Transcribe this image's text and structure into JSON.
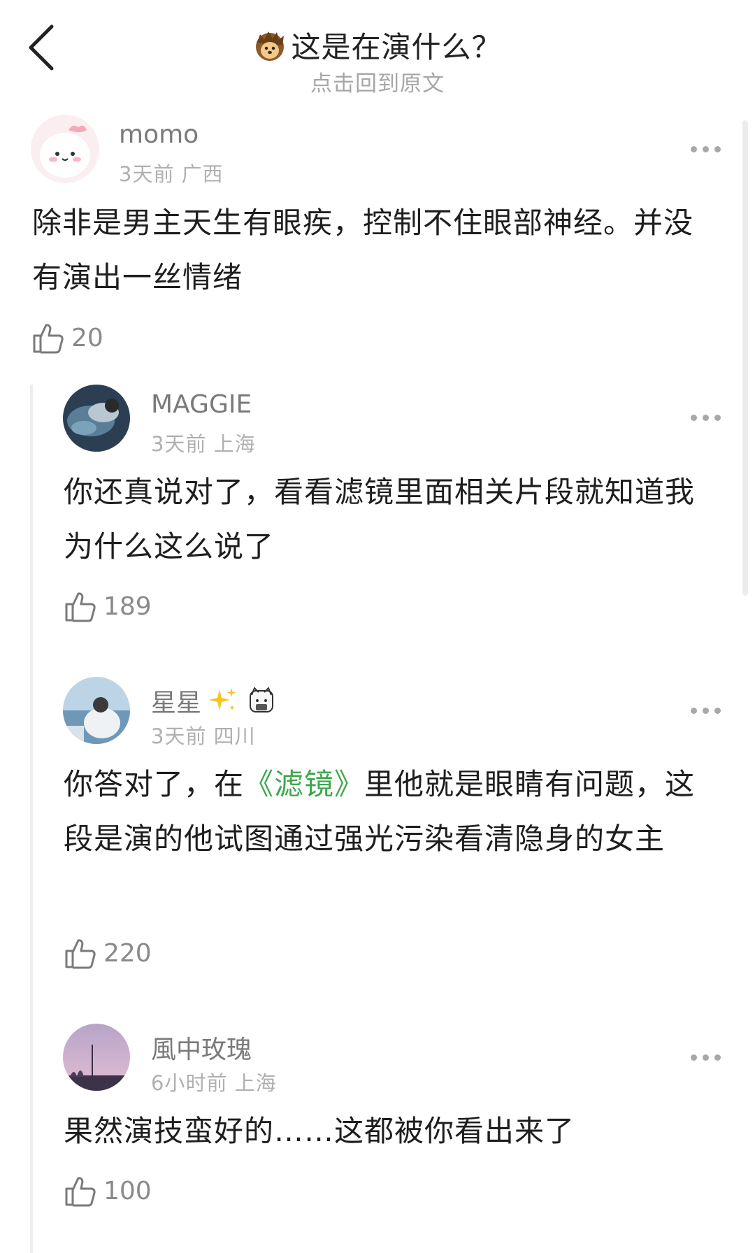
{
  "header": {
    "title": "这是在演什么？",
    "subtitle": "点击回到原文"
  },
  "comments": [
    {
      "username": "momo",
      "time": "3天前",
      "location": "广西",
      "body": "除非是男主天生有眼疾，控制不住眼部神经。并没有演出一丝情绪",
      "likes": "20"
    },
    {
      "username": "MAGGIE",
      "time": "3天前",
      "location": "上海",
      "body": "你还真说对了，看看滤镜里面相关片段就知道我为什么这么说了",
      "likes": "189"
    },
    {
      "username": "星星",
      "time": "3天前",
      "location": "四川",
      "body_parts": [
        "你答对了，在",
        "《滤镜》",
        "里他就是眼睛有问题，这段是演的他试图通过强光污染看清隐身的女主"
      ],
      "likes": "220"
    },
    {
      "username": "風中玫瑰",
      "time": "6小时前",
      "location": "上海",
      "body": "果然演技蛮好的……这都被你看出来了",
      "likes": "100"
    }
  ],
  "colors": {
    "link_green": "#3ea64d",
    "muted_gray": "#b0b0b0",
    "thread_line": "#ededed"
  },
  "icons": {
    "back": "chevron-left-icon",
    "title_emoji": "hedgehog-emoji-icon",
    "more": "ellipsis-icon",
    "like": "thumbs-up-icon",
    "username_badge": "sparkles-icon",
    "username_sticker": "sticker-icon"
  }
}
